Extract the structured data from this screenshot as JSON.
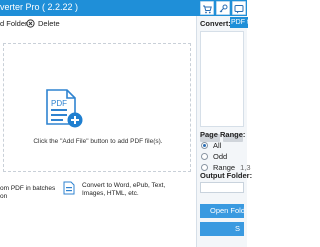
{
  "titlebar": {
    "title": "verter Pro  ( 2.2.22 )",
    "icons": [
      "cart-icon",
      "key-icon",
      "feedback-icon"
    ]
  },
  "toolbar": {
    "add_folder_label": "d Folder",
    "delete_label": "Delete"
  },
  "drop_zone": {
    "icon_text": "PDF",
    "hint": "Click the \"Add File\" button to add PDF file(s)."
  },
  "features": {
    "batch_text": "om PDF in batches on",
    "convert_text": "Convert to Word, ePub, Text, Images, HTML, etc."
  },
  "side": {
    "convert_label": "Convert:",
    "convert_value": "PDF t",
    "page_range_label": "Page Range:",
    "range_options": [
      "All",
      "Odd",
      "Range"
    ],
    "range_selected": "All",
    "range_value": "1,3",
    "output_folder_label": "Output Folder:",
    "open_folder_label": "Open Folder",
    "start_label": "S"
  },
  "colors": {
    "accent": "#1f8fd8",
    "button": "#3a9ae0",
    "pdf_icon": "#2f83d0",
    "plus_badge": "#1f7fd0"
  }
}
